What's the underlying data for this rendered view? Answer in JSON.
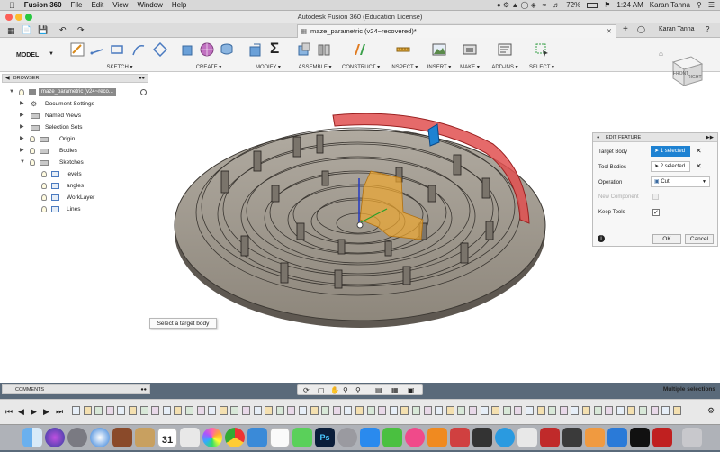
{
  "menubar": {
    "app_name": "Fusion 360",
    "menus": [
      "File",
      "Edit",
      "View",
      "Window",
      "Help"
    ],
    "battery": "72%",
    "time": "1:24 AM",
    "user": "Karan Tanna"
  },
  "window": {
    "title": "Autodesk Fusion 360 (Education License)",
    "doc_tab": "maze_parametric (v24~recovered)*",
    "account": "Karan Tanna"
  },
  "toolbar": {
    "workspace": "MODEL",
    "groups": [
      "SKETCH",
      "CREATE",
      "MODIFY",
      "ASSEMBLE",
      "CONSTRUCT",
      "INSPECT",
      "INSERT",
      "MAKE",
      "ADD-INS",
      "SELECT"
    ]
  },
  "browser": {
    "header": "BROWSER",
    "root": "maze_parametric (v24~reco...",
    "items": [
      {
        "label": "Document Settings"
      },
      {
        "label": "Named Views"
      },
      {
        "label": "Selection Sets"
      },
      {
        "label": "Origin"
      },
      {
        "label": "Bodies"
      },
      {
        "label": "Sketches"
      },
      {
        "label": "levels"
      },
      {
        "label": "angles"
      },
      {
        "label": "WorkLayer"
      },
      {
        "label": "Lines"
      }
    ]
  },
  "edit_feature": {
    "header": "EDIT FEATURE",
    "target_body_label": "Target Body",
    "target_body_value": "1 selected",
    "tool_bodies_label": "Tool Bodies",
    "tool_bodies_value": "2 selected",
    "operation_label": "Operation",
    "operation_value": "Cut",
    "new_component_label": "New Component",
    "keep_tools_label": "Keep Tools",
    "ok_label": "OK",
    "cancel_label": "Cancel"
  },
  "tooltip": "Select a target body",
  "comments_header": "COMMENTS",
  "status": "Multiple selections",
  "calendar_day": "31",
  "colors": {
    "selected_red": "#e05050",
    "tool_orange": "#f0a830",
    "accent_blue": "#1e82d2"
  }
}
